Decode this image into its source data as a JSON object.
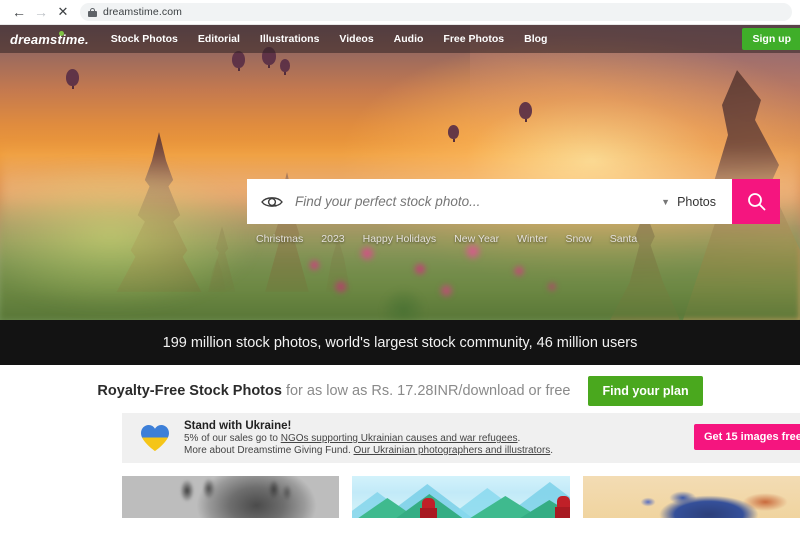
{
  "browser": {
    "back_icon": "arrow-left-icon",
    "forward_icon": "arrow-right-icon",
    "stop_icon": "close-icon",
    "lock_icon": "lock-icon",
    "url": "dreamstime.com"
  },
  "header": {
    "logo": "dreamstime.",
    "nav": [
      {
        "label": "Stock Photos"
      },
      {
        "label": "Editorial"
      },
      {
        "label": "Illustrations"
      },
      {
        "label": "Videos"
      },
      {
        "label": "Audio"
      },
      {
        "label": "Free Photos"
      },
      {
        "label": "Blog"
      }
    ],
    "signup_label": "Sign up",
    "signup_color": "#3fae29"
  },
  "search": {
    "visual_search_icon": "eye-search-icon",
    "placeholder": "Find your perfect stock photo...",
    "value": "",
    "type_selected": "Photos",
    "chevron_icon": "chevron-down-icon",
    "search_icon": "search-icon",
    "button_color": "#f5157f",
    "tags": [
      "Christmas",
      "2023",
      "Happy Holidays",
      "New Year",
      "Winter",
      "Snow",
      "Santa"
    ]
  },
  "stats": {
    "text": "199 million stock photos, world's largest stock community, 46 million users"
  },
  "royalty": {
    "title": "Royalty-Free Stock Photos",
    "subtitle": " for as low as Rs. 17.28INR/download or free",
    "button_label": "Find your plan",
    "button_color": "#4aa81e"
  },
  "ukraine": {
    "heart_icon": "ukraine-heart-icon",
    "title": "Stand with Ukraine!",
    "line1_prefix": "5% of our sales go to ",
    "line1_link": "NGOs supporting Ukrainian causes and war refugees",
    "line1_suffix": ".",
    "line2_prefix": "More about Dreamstime Giving Fund. ",
    "line2_link": "Our Ukrainian photographers and illustrators",
    "line2_suffix": ".",
    "button_label": "Get 15 images free",
    "button_color": "#f5157f",
    "flag_blue": "#3d7fd8",
    "flag_yellow": "#f5c518"
  },
  "thumbnails": [
    {
      "name": "grayscale-horses"
    },
    {
      "name": "mountains-with-red-figures"
    },
    {
      "name": "blue-orange-creature"
    }
  ]
}
